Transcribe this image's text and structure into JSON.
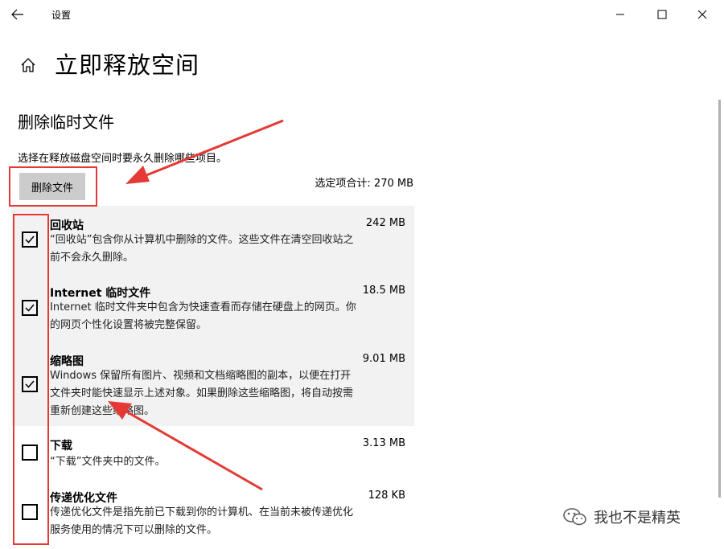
{
  "window": {
    "title": "设置",
    "back_icon": "arrow-left-icon",
    "controls": [
      "minimize-icon",
      "maximize-icon",
      "close-icon"
    ]
  },
  "page": {
    "title": "立即释放空间",
    "home_icon": "home-icon"
  },
  "section": {
    "title": "删除临时文件",
    "description": "选择在释放磁盘空间时要永久删除哪些项目。",
    "delete_button": "删除文件",
    "total": "选定项合计: 270 MB"
  },
  "items": [
    {
      "name": "回收站",
      "size": "242 MB",
      "checked": true,
      "desc": [
        "“回收站”包含你从计算机中删除的文件。这些文件在清空回收站之",
        "前不会永久删除。"
      ]
    },
    {
      "name": "Internet 临时文件",
      "size": "18.5 MB",
      "checked": true,
      "desc": [
        "Internet 临时文件夹中包含为快速查看而存储在硬盘上的网页。你",
        "的网页个性化设置将被完整保留。"
      ]
    },
    {
      "name": "缩略图",
      "size": "9.01 MB",
      "checked": true,
      "desc": [
        "Windows 保留所有图片、视频和文档缩略图的副本，以便在打开",
        "文件夹时能快速显示上述对象。如果删除这些缩略图，将自动按需",
        "重新创建这些缩略图。"
      ]
    },
    {
      "name": "下载",
      "size": "3.13 MB",
      "checked": false,
      "desc": [
        "“下载”文件夹中的文件。"
      ]
    },
    {
      "name": "传递优化文件",
      "size": "128 KB",
      "checked": false,
      "desc": [
        "传递优化文件是指先前已下载到你的计算机、在当前未被传递优化",
        "服务使用的情况下可以删除的文件。"
      ]
    }
  ],
  "watermark": {
    "text": "我也不是精英",
    "icon": "wechat-icon"
  },
  "colors": {
    "annotation": "#e53935",
    "selected_bg": "#f2f2f2",
    "button_bg": "#cccccc"
  }
}
